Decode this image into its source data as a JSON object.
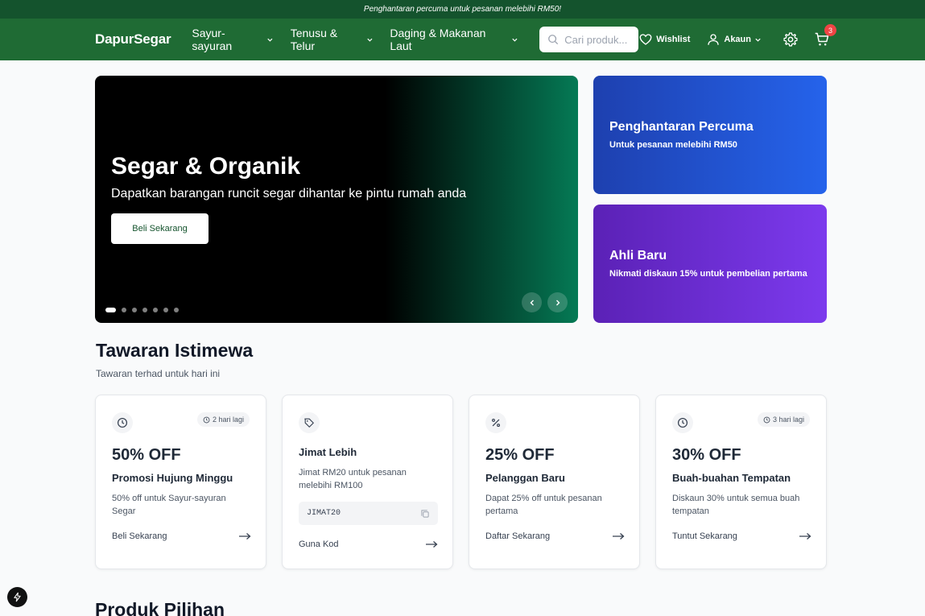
{
  "topbar": {
    "text": "Penghantaran percuma untuk pesanan melebihi RM50!"
  },
  "nav": {
    "logo": "DapurSegar",
    "menu": [
      {
        "label": "Sayur-sayuran"
      },
      {
        "label": "Tenusu & Telur"
      },
      {
        "label": "Daging & Makanan Laut"
      }
    ],
    "search_placeholder": "Cari produk...",
    "wishlist": "Wishlist",
    "account": "Akaun",
    "cart_count": "3"
  },
  "hero": {
    "title": "Segar & Organik",
    "subtitle": "Dapatkan barangan runcit segar dihantar ke pintu rumah anda",
    "button": "Beli Sekarang",
    "slide_count": 7,
    "active_slide": 1
  },
  "side_cards": [
    {
      "title": "Penghantaran Percuma",
      "subtitle": "Untuk pesanan melebihi RM50"
    },
    {
      "title": "Ahli Baru",
      "subtitle": "Nikmati diskaun 15% untuk pembelian pertama"
    }
  ],
  "offers_section": {
    "title": "Tawaran Istimewa",
    "subtitle": "Tawaran terhad untuk hari ini"
  },
  "offers": [
    {
      "icon": "clock-icon",
      "badge": "2 hari lagi",
      "headline": "50% OFF",
      "name": "Promosi Hujung Minggu",
      "desc": "50% off untuk Sayur-sayuran Segar",
      "link": "Beli Sekarang"
    },
    {
      "icon": "tag-icon",
      "name": "Jimat Lebih",
      "desc": "Jimat RM20 untuk pesanan melebihi RM100",
      "code": "JIMAT20",
      "link": "Guna Kod"
    },
    {
      "icon": "percent-icon",
      "headline": "25% OFF",
      "name": "Pelanggan Baru",
      "desc": "Dapat 25% off untuk pesanan pertama",
      "link": "Daftar Sekarang"
    },
    {
      "icon": "clock-icon",
      "badge": "3 hari lagi",
      "headline": "30% OFF",
      "name": "Buah-buahan Tempatan",
      "desc": "Diskaun 30% untuk semua buah tempatan",
      "link": "Tuntut Sekarang"
    }
  ],
  "featured": {
    "title": "Produk Pilihan"
  },
  "colors": {
    "nav_green": "#1f6b34",
    "topbar_green": "#14532d",
    "badge_red": "#ef4444",
    "blue_card": "#2563eb",
    "purple_card": "#7c3aed"
  }
}
